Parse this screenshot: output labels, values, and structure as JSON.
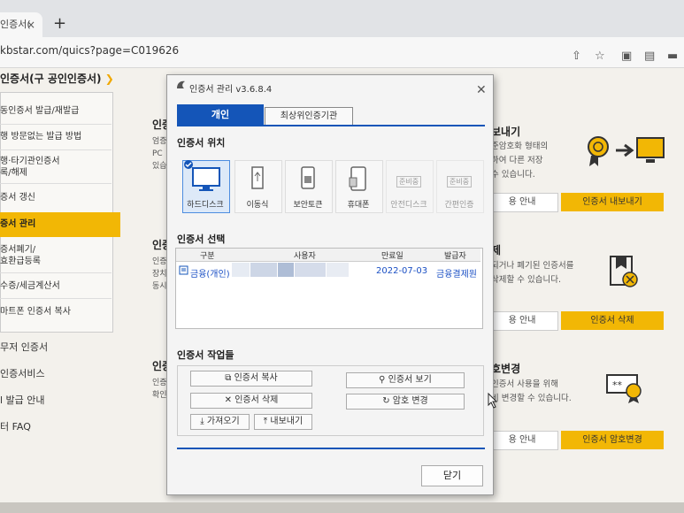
{
  "browser": {
    "tab_text": "인증서(",
    "url": "kbstar.com/quics?page=C019626",
    "newtab": "+",
    "close": "×"
  },
  "page": {
    "heading": "인증서(구 공인인증서)",
    "sidebar": [
      "동인증서 발급/재발급",
      "행 방문없는 발급 방법",
      "행·타기관인증서",
      "록/해제",
      "증서 갱신",
      "증서 관리",
      "증서폐기/",
      "효환급등록",
      "수증/세금계산서",
      "마트폰 인증서 복사"
    ],
    "lower_items": [
      "무저 인증서",
      "인증서비스",
      "l 발급 안내",
      "터 FAQ"
    ],
    "mid": [
      {
        "head": "인증",
        "lines": [
          "엄증",
          "PC",
          "있습"
        ]
      },
      {
        "head": "인증",
        "lines": [
          "인증",
          "장치",
          "동시"
        ]
      },
      {
        "head": "인증",
        "lines": [
          "인증",
          "확인"
        ]
      }
    ],
    "right": [
      {
        "title": "보내기",
        "lines": [
          "준암호화 형태의",
          "하여 다른 저장",
          "수 있습니다."
        ],
        "btn_info": "용 안내",
        "btn_action": "인증서 내보내기"
      },
      {
        "title": "제",
        "lines": [
          "되거나 폐기된 인증서를",
          "삭제할 수 있습니다."
        ],
        "btn_info": "용 안내",
        "btn_action": "인증서 삭제"
      },
      {
        "title": "호변경",
        "lines": [
          "인증서 사용을 위해",
          "비 변경할 수 있습니다."
        ],
        "btn_info": "용 안내",
        "btn_action": "인증서 암호변경"
      }
    ]
  },
  "dialog": {
    "title": "인증서 관리 v3.6.8.4",
    "tabs": [
      "개인",
      "최상위인증기관"
    ],
    "location_title": "인증서 위치",
    "locations": [
      "하드디스크",
      "이동식",
      "보안토큰",
      "휴대폰",
      "안전디스크",
      "간편인증"
    ],
    "location_badge": "준비중",
    "selection_title": "인증서 선택",
    "columns": [
      "구분",
      "사용자",
      "만료일",
      "발급자"
    ],
    "rows": [
      {
        "type": "금융(개인)",
        "user": "",
        "expiry": "2022-07-03",
        "issuer": "금융결제원"
      }
    ],
    "ops_title": "인증서 작업들",
    "ops": {
      "copy": "인증서 복사",
      "delete": "인증서 삭제",
      "import": "가져오기",
      "export": "내보내기",
      "view": "인증서 보기",
      "change_pw": "암호 변경"
    },
    "close_btn": "닫기"
  },
  "colors": {
    "accent": "#1455b8",
    "brand": "#f2b705"
  }
}
